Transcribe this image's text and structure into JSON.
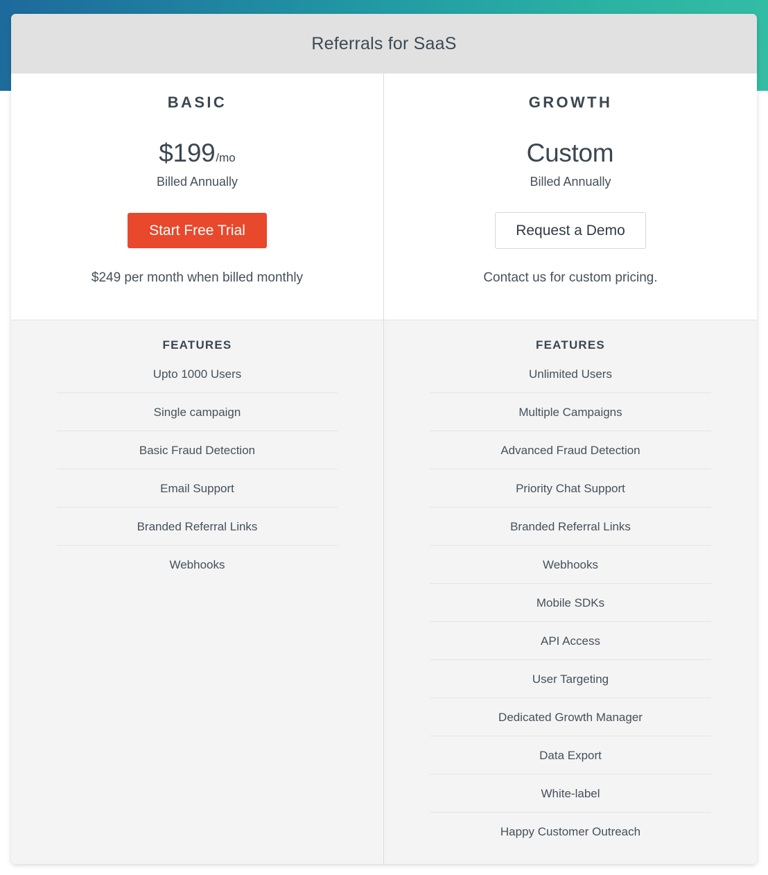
{
  "header": {
    "title": "Referrals for SaaS"
  },
  "theme": {
    "gradient_start": "#1d6a9c",
    "gradient_end": "#34bda4",
    "primary_button": "#e8482c",
    "header_background": "#e1e1e1",
    "features_background": "#f4f4f4"
  },
  "plans": [
    {
      "name": "BASIC",
      "price_amount": "$199",
      "price_period": "/mo",
      "billing": "Billed Annually",
      "cta_label": "Start Free Trial",
      "cta_style": "primary",
      "note": "$249 per month when billed monthly",
      "features_heading": "FEATURES",
      "features": [
        "Upto 1000 Users",
        "Single campaign",
        "Basic Fraud Detection",
        "Email Support",
        "Branded Referral Links",
        "Webhooks"
      ]
    },
    {
      "name": "GROWTH",
      "price_amount": "Custom",
      "price_period": "",
      "billing": "Billed Annually",
      "cta_label": "Request a Demo",
      "cta_style": "secondary",
      "note": "Contact us for custom pricing.",
      "features_heading": "FEATURES",
      "features": [
        "Unlimited Users",
        "Multiple Campaigns",
        "Advanced Fraud Detection",
        "Priority Chat Support",
        "Branded Referral Links",
        "Webhooks",
        "Mobile SDKs",
        "API Access",
        "User Targeting",
        "Dedicated Growth Manager",
        "Data Export",
        "White-label",
        "Happy Customer Outreach"
      ]
    }
  ]
}
